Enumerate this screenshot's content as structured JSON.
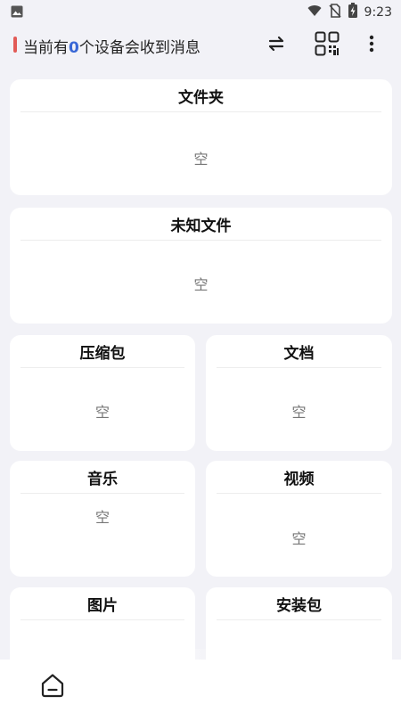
{
  "status_bar": {
    "time": "9:23"
  },
  "header": {
    "title_prefix": "当前有",
    "device_count": "0",
    "title_suffix": "个设备会收到消息"
  },
  "cards": {
    "folder": {
      "title": "文件夹",
      "empty": "空"
    },
    "unknown": {
      "title": "未知文件",
      "empty": "空"
    },
    "archive": {
      "title": "压缩包",
      "empty": "空"
    },
    "document": {
      "title": "文档",
      "empty": "空"
    },
    "music": {
      "title": "音乐",
      "empty": "空"
    },
    "video": {
      "title": "视频",
      "empty": "空"
    },
    "image": {
      "title": "图片",
      "empty": ""
    },
    "apk": {
      "title": "安装包",
      "empty": ""
    }
  },
  "icons": {
    "status": [
      "image-icon",
      "wifi-icon",
      "no-sim-icon",
      "battery-charging-icon"
    ],
    "header": [
      "swap-icon",
      "qr-code-icon",
      "more-vert-icon"
    ],
    "bottom": [
      "home-icon"
    ]
  },
  "colors": {
    "accent": "#E25B57",
    "count": "#3867D6",
    "background": "#F2F2F7",
    "card": "#FFFFFF"
  }
}
